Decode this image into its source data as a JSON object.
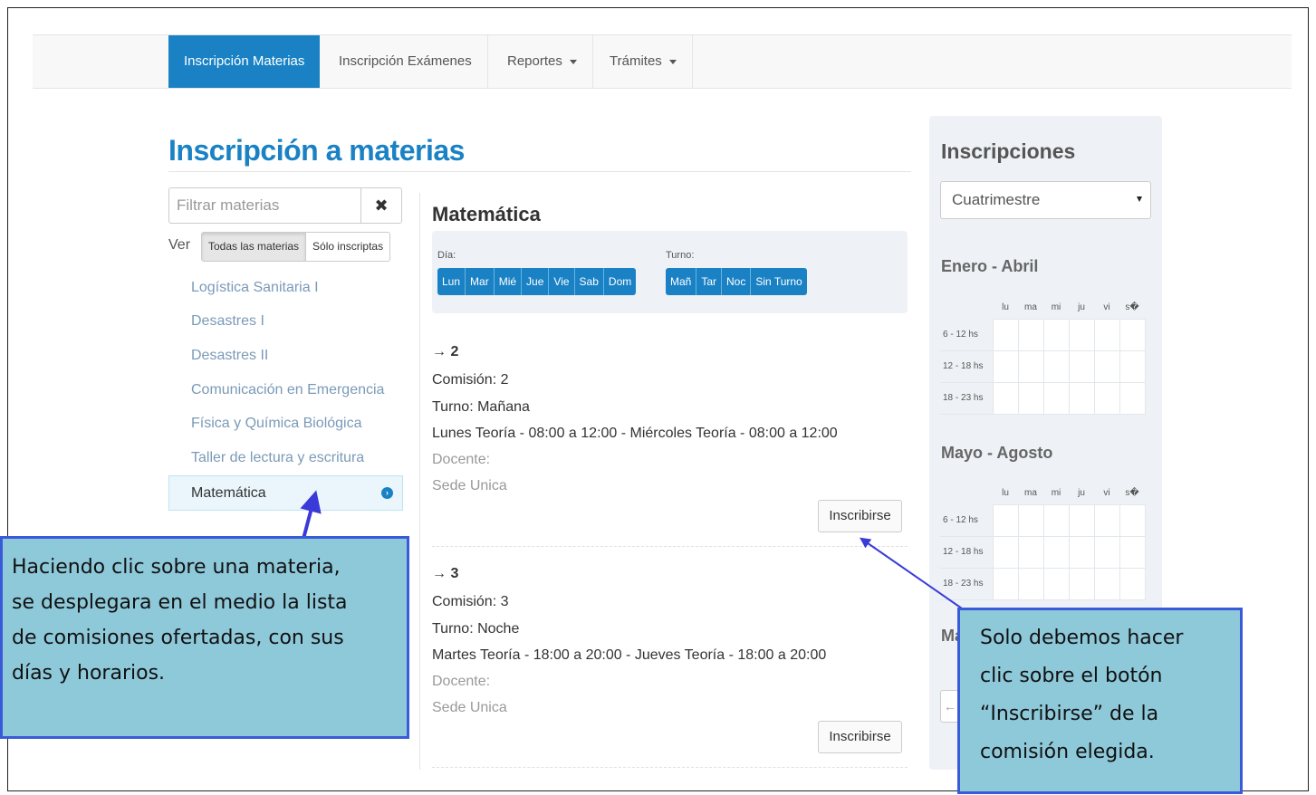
{
  "navbar": {
    "items": [
      {
        "label": "Inscripción Materias",
        "active": true
      },
      {
        "label": "Inscripción Exámenes",
        "active": false
      },
      {
        "label": "Reportes",
        "dropdown": true
      },
      {
        "label": "Trámites",
        "dropdown": true
      }
    ]
  },
  "page": {
    "title": "Inscripción a materias"
  },
  "filter": {
    "placeholder": "Filtrar materias",
    "clear_icon": "✖"
  },
  "view": {
    "label": "Ver",
    "options": [
      "Todas las materias",
      "Sólo inscriptas"
    ],
    "selected": "Todas las materias"
  },
  "subjects": [
    "Logística Sanitaria I",
    "Desastres I",
    "Desastres II",
    "Comunicación en Emergencia",
    "Física y Química Biológica",
    "Taller de lectura y escritura",
    "Matemática"
  ],
  "selected_subject": "Matemática",
  "detail": {
    "title": "Matemática",
    "day_label": "Día:",
    "days": [
      "Lun",
      "Mar",
      "Mié",
      "Jue",
      "Vie",
      "Sab",
      "Dom"
    ],
    "shift_label": "Turno:",
    "shifts": [
      "Mañ",
      "Tar",
      "Noc",
      "Sin Turno"
    ],
    "commissions": [
      {
        "heading": "→ 2",
        "comision": "Comisión: 2",
        "turno": "Turno: Mañana",
        "horario": "Lunes Teoría - 08:00 a 12:00 - Miércoles Teoría - 08:00 a 12:00",
        "docente": "Docente:",
        "sede": "Sede Unica",
        "button": "Inscribirse"
      },
      {
        "heading": "→ 3",
        "comision": "Comisión: 3",
        "turno": "Turno: Noche",
        "horario": "Martes Teoría - 18:00 a 20:00 - Jueves Teoría - 18:00 a 20:00",
        "docente": "Docente:",
        "sede": "Sede Unica",
        "button": "Inscribirse"
      }
    ]
  },
  "sidebar": {
    "title": "Inscripciones",
    "select_value": "Cuatrimestre",
    "day_headers": [
      "lu",
      "ma",
      "mi",
      "ju",
      "vi",
      "s�"
    ],
    "periods": [
      {
        "name": "Enero - Abril",
        "rows": [
          "6 - 12 hs",
          "12 - 18 hs",
          "18 - 23 hs"
        ]
      },
      {
        "name": "Mayo - Agosto",
        "rows": [
          "6 - 12 hs",
          "12 - 18 hs",
          "18 - 23 hs"
        ]
      }
    ],
    "partial_heading": "Ma",
    "partial_button": "←"
  },
  "callouts": {
    "left": [
      "Haciendo clic sobre una materia,",
      "se desplegara en el medio la lista",
      "de comisiones ofertadas, con sus",
      "días y horarios."
    ],
    "right": [
      "Solo debemos hacer",
      "clic sobre el botón",
      "“Inscribirse” de la",
      "comisión elegida."
    ]
  },
  "colors": {
    "primary": "#1a82c4",
    "callout_fill": "#8ec9da",
    "callout_border": "#3a5bd9",
    "link": "#7a9ab8"
  }
}
